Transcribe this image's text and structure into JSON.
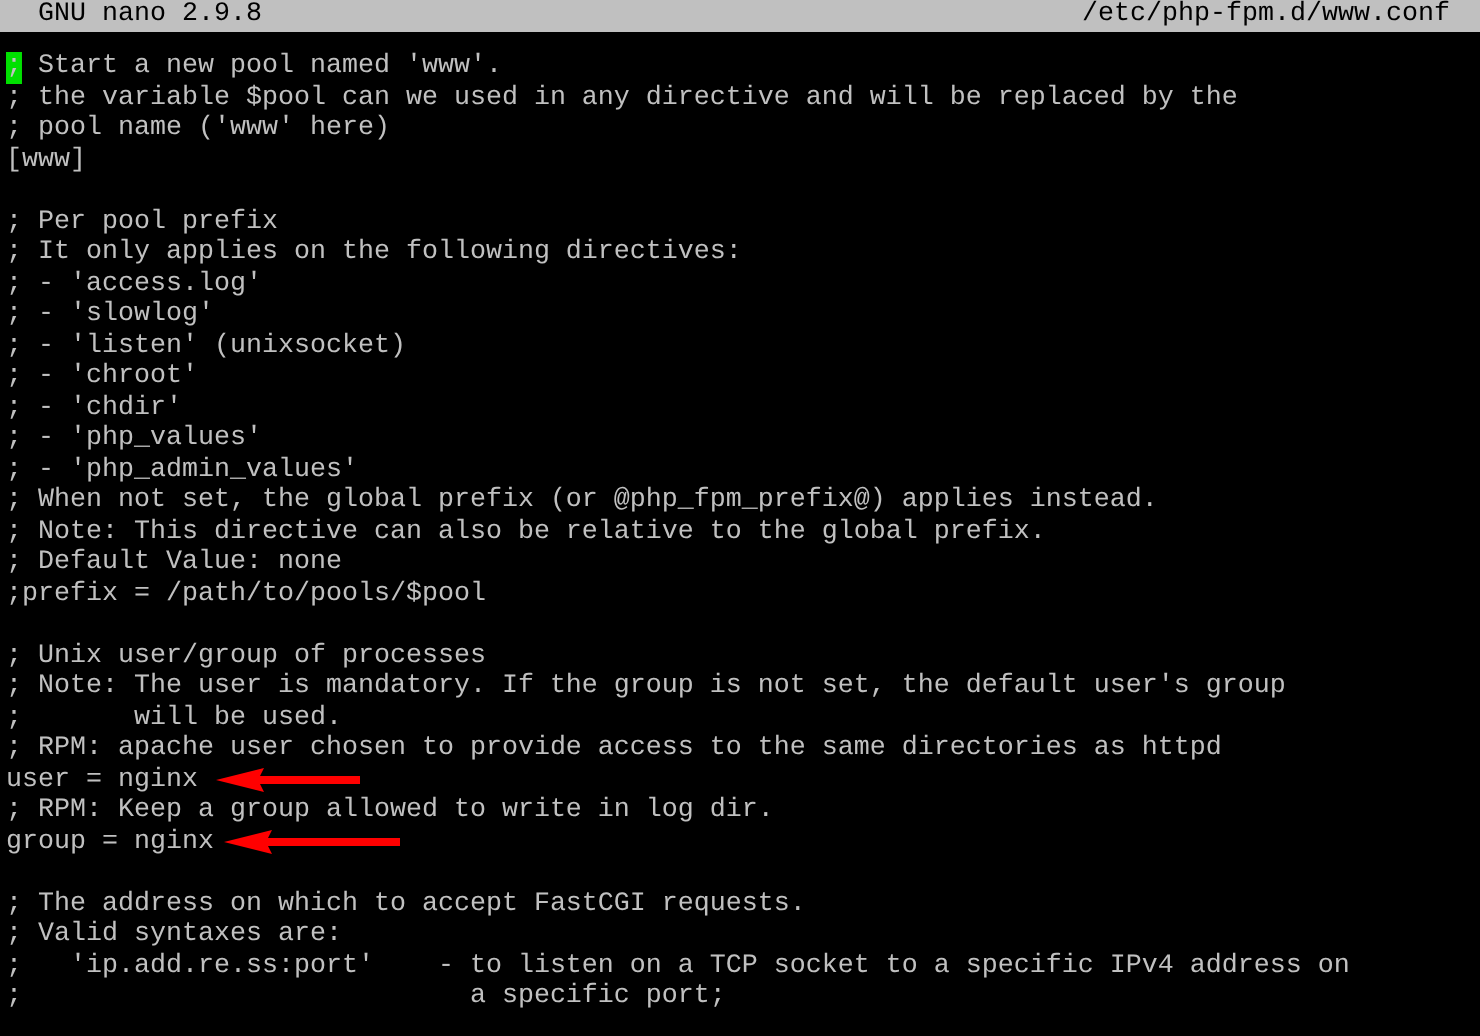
{
  "title_bar": {
    "program": "GNU nano 2.9.8",
    "file": "/etc/php-fpm.d/www.conf"
  },
  "lines": [
    {
      "kind": "text",
      "text": "; Start a new pool named 'www'.",
      "cursor": true
    },
    {
      "kind": "text",
      "text": "; the variable $pool can we used in any directive and will be replaced by the",
      "cursor": false
    },
    {
      "kind": "text",
      "text": "; pool name ('www' here)",
      "cursor": false
    },
    {
      "kind": "text",
      "text": "[www]",
      "cursor": false
    },
    {
      "kind": "blank"
    },
    {
      "kind": "text",
      "text": "; Per pool prefix",
      "cursor": false
    },
    {
      "kind": "text",
      "text": "; It only applies on the following directives:",
      "cursor": false
    },
    {
      "kind": "text",
      "text": "; - 'access.log'",
      "cursor": false
    },
    {
      "kind": "text",
      "text": "; - 'slowlog'",
      "cursor": false
    },
    {
      "kind": "text",
      "text": "; - 'listen' (unixsocket)",
      "cursor": false
    },
    {
      "kind": "text",
      "text": "; - 'chroot'",
      "cursor": false
    },
    {
      "kind": "text",
      "text": "; - 'chdir'",
      "cursor": false
    },
    {
      "kind": "text",
      "text": "; - 'php_values'",
      "cursor": false
    },
    {
      "kind": "text",
      "text": "; - 'php_admin_values'",
      "cursor": false
    },
    {
      "kind": "text",
      "text": "; When not set, the global prefix (or @php_fpm_prefix@) applies instead.",
      "cursor": false
    },
    {
      "kind": "text",
      "text": "; Note: This directive can also be relative to the global prefix.",
      "cursor": false
    },
    {
      "kind": "text",
      "text": "; Default Value: none",
      "cursor": false
    },
    {
      "kind": "text",
      "text": ";prefix = /path/to/pools/$pool",
      "cursor": false
    },
    {
      "kind": "blank"
    },
    {
      "kind": "text",
      "text": "; Unix user/group of processes",
      "cursor": false
    },
    {
      "kind": "text",
      "text": "; Note: The user is mandatory. If the group is not set, the default user's group",
      "cursor": false
    },
    {
      "kind": "text",
      "text": ";       will be used.",
      "cursor": false
    },
    {
      "kind": "text",
      "text": "; RPM: apache user chosen to provide access to the same directories as httpd",
      "cursor": false
    },
    {
      "kind": "text",
      "text": "user = nginx",
      "cursor": false
    },
    {
      "kind": "text",
      "text": "; RPM: Keep a group allowed to write in log dir.",
      "cursor": false
    },
    {
      "kind": "text",
      "text": "group = nginx",
      "cursor": false
    },
    {
      "kind": "blank"
    },
    {
      "kind": "text",
      "text": "; The address on which to accept FastCGI requests.",
      "cursor": false
    },
    {
      "kind": "text",
      "text": "; Valid syntaxes are:",
      "cursor": false
    },
    {
      "kind": "text",
      "text": ";   'ip.add.re.ss:port'    - to listen on a TCP socket to a specific IPv4 address on",
      "cursor": false
    },
    {
      "kind": "text",
      "text": ";                            a specific port;",
      "cursor": false
    }
  ],
  "annotations": [
    {
      "kind": "arrow"
    },
    {
      "kind": "arrow"
    }
  ]
}
